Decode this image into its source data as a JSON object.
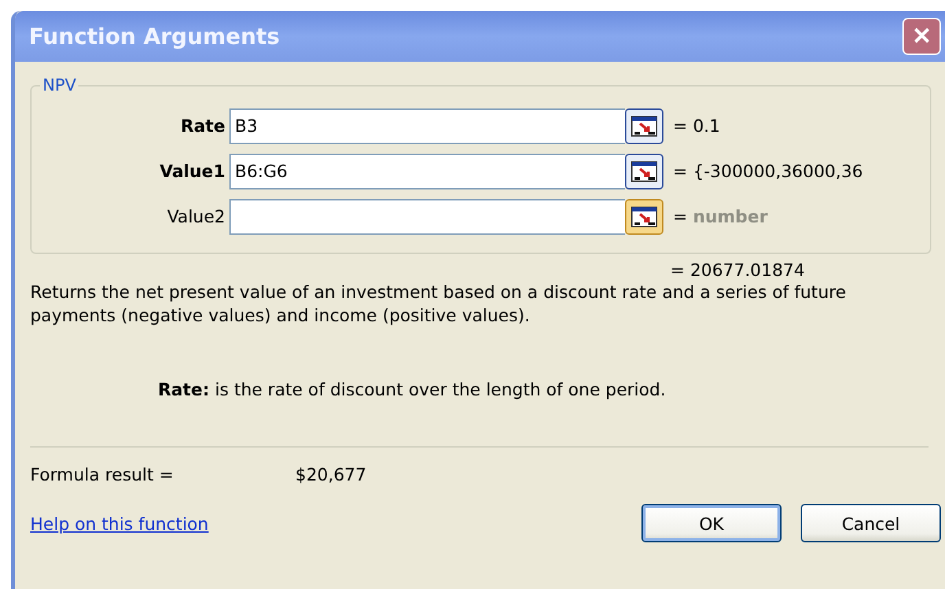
{
  "window": {
    "title": "Function Arguments",
    "close": "✕"
  },
  "function": {
    "name": "NPV",
    "arguments": [
      {
        "label": "Rate",
        "required": true,
        "value": "B3",
        "result": "= 0.1",
        "hint": false
      },
      {
        "label": "Value1",
        "required": true,
        "value": "B6:G6",
        "result": "= {-300000,36000,36",
        "hint": false
      },
      {
        "label": "Value2",
        "required": false,
        "result": "= ",
        "hint_text": "number",
        "hint": true
      }
    ]
  },
  "result": "= 20677.01874",
  "description": "Returns the net present value of an investment based on a discount rate and a series of future payments (negative values) and income (positive values).",
  "argument_help": "**Rate:** is the rate of discount over the length of one period.",
  "formula_result": {
    "label": "Formula result =",
    "value": "$20,677"
  },
  "help_link": "Help on this function",
  "buttons": [
    {
      "label": "OK",
      "default": true
    },
    {
      "label": "Cancel",
      "default": false
    }
  ]
}
